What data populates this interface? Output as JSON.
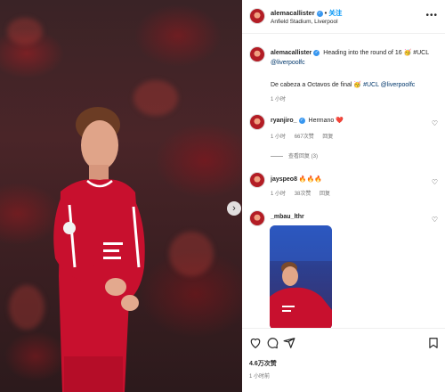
{
  "post": {
    "username": "alemacallister",
    "follow_label": "关注",
    "separator": "•",
    "location": "Anfield Stadium, Liverpool",
    "more_icon": "more-horizontal-icon"
  },
  "caption": {
    "username": "alemacallister",
    "text_line1": "Heading into the round of 16 🥳 #UCL",
    "text_line1_tag": "@liverpoolfc",
    "text_line2": "De cabeza a Octavos de final 🥳",
    "text_line2_tags": "#UCL @liverpoolfc",
    "time": "1 小时"
  },
  "comments": [
    {
      "username": "ryanjiro_",
      "text": "Hermano ❤️",
      "time": "1 小时",
      "likes": "667次赞",
      "reply": "回复",
      "view_replies": "查看回复 (3)"
    },
    {
      "username": "jayspeo8",
      "text": "🔥🔥🔥",
      "time": "1 小时",
      "likes": "38次赞",
      "reply": "回复"
    },
    {
      "username": "_mbau_lthr",
      "text": ""
    }
  ],
  "actions": {
    "like_icon": "heart-icon",
    "comment_icon": "comment-icon",
    "share_icon": "send-icon",
    "save_icon": "bookmark-icon"
  },
  "likes_count": "4.6万次赞",
  "post_time": "1 小时前",
  "colors": {
    "link_blue": "#0095f6",
    "liverpool_red": "#c8102e",
    "verified_blue": "#3897f0"
  }
}
